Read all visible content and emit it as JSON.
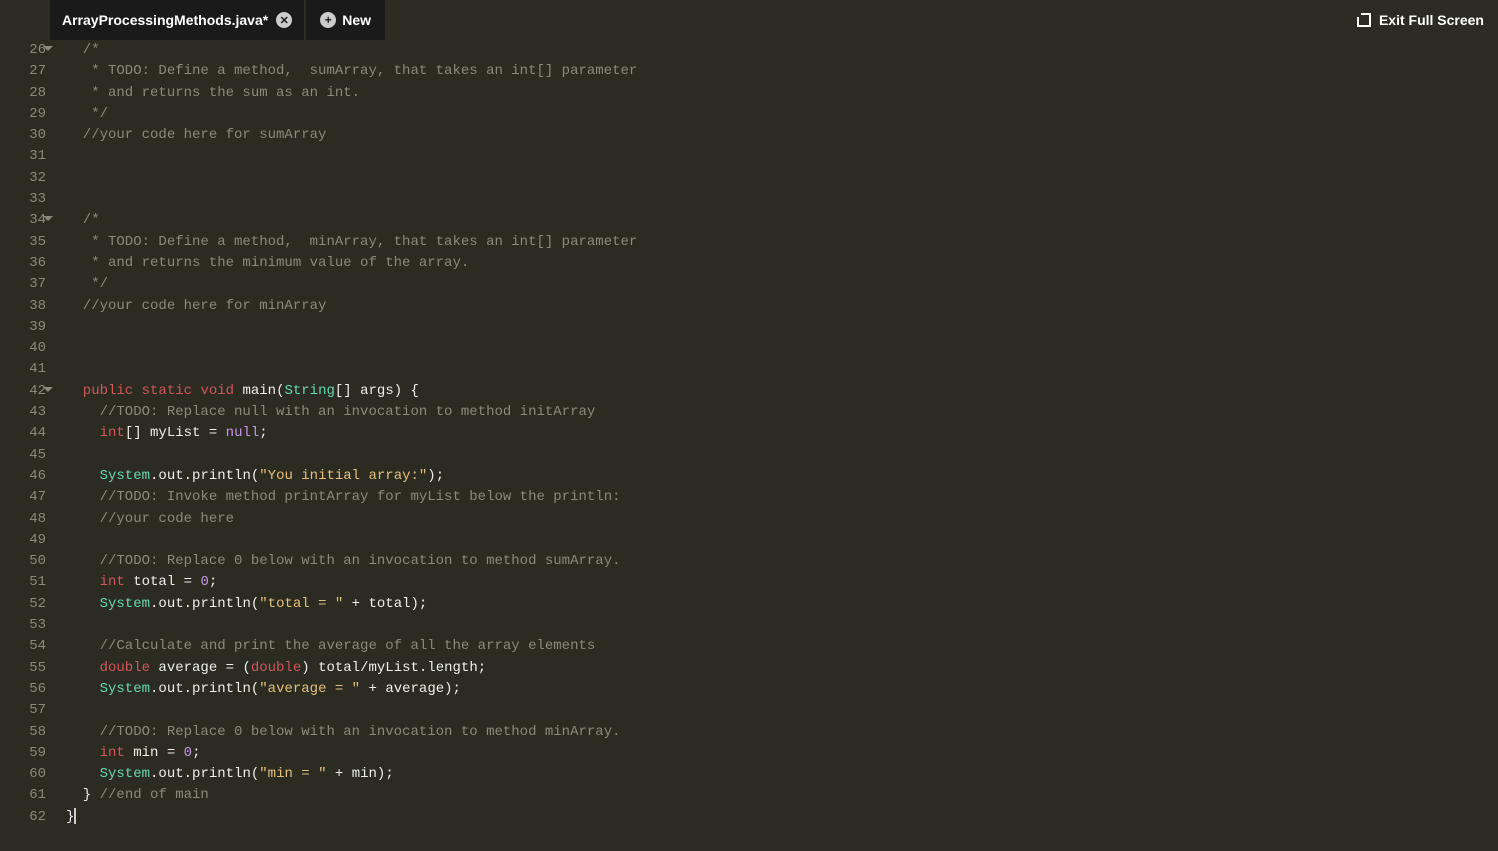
{
  "titlebar": {
    "tab_name": "ArrayProcessingMethods.java*",
    "new_label": "New",
    "exit_label": "Exit Full Screen"
  },
  "gutter": {
    "start": 26,
    "end": 62,
    "folds": [
      26,
      34,
      42
    ]
  },
  "code": {
    "lines": [
      {
        "n": 26,
        "t": "comment",
        "s": "  /*"
      },
      {
        "n": 27,
        "t": "comment",
        "s": "   * TODO: Define a method,  sumArray, that takes an int[] parameter"
      },
      {
        "n": 28,
        "t": "comment",
        "s": "   * and returns the sum as an int."
      },
      {
        "n": 29,
        "t": "comment",
        "s": "   */"
      },
      {
        "n": 30,
        "t": "comment",
        "s": "  //your code here for sumArray"
      },
      {
        "n": 31,
        "t": "blank",
        "s": ""
      },
      {
        "n": 32,
        "t": "blank",
        "s": ""
      },
      {
        "n": 33,
        "t": "blank",
        "s": ""
      },
      {
        "n": 34,
        "t": "comment",
        "s": "  /*"
      },
      {
        "n": 35,
        "t": "comment",
        "s": "   * TODO: Define a method,  minArray, that takes an int[] parameter"
      },
      {
        "n": 36,
        "t": "comment",
        "s": "   * and returns the minimum value of the array."
      },
      {
        "n": 37,
        "t": "comment",
        "s": "   */"
      },
      {
        "n": 38,
        "t": "comment",
        "s": "  //your code here for minArray"
      },
      {
        "n": 39,
        "t": "blank",
        "s": ""
      },
      {
        "n": 40,
        "t": "blank",
        "s": ""
      },
      {
        "n": 41,
        "t": "blank",
        "s": ""
      },
      {
        "n": 42,
        "t": "sig",
        "tokens": [
          {
            "c": "kw",
            "v": "  public "
          },
          {
            "c": "kw",
            "v": "static "
          },
          {
            "c": "kw",
            "v": "void "
          },
          {
            "c": "id",
            "v": "main"
          },
          {
            "c": "punc",
            "v": "("
          },
          {
            "c": "type",
            "v": "String"
          },
          {
            "c": "punc",
            "v": "[] "
          },
          {
            "c": "id",
            "v": "args"
          },
          {
            "c": "punc",
            "v": ") {"
          }
        ]
      },
      {
        "n": 43,
        "t": "comment",
        "s": "    //TODO: Replace null with an invocation to method initArray"
      },
      {
        "n": 44,
        "t": "stmt",
        "tokens": [
          {
            "c": "kw",
            "v": "    int"
          },
          {
            "c": "punc",
            "v": "[] "
          },
          {
            "c": "id",
            "v": "myList"
          },
          {
            "c": "punc",
            "v": " = "
          },
          {
            "c": "lit",
            "v": "null"
          },
          {
            "c": "punc",
            "v": ";"
          }
        ]
      },
      {
        "n": 45,
        "t": "blank",
        "s": ""
      },
      {
        "n": 46,
        "t": "stmt",
        "tokens": [
          {
            "c": "type",
            "v": "    System"
          },
          {
            "c": "punc",
            "v": "."
          },
          {
            "c": "id",
            "v": "out"
          },
          {
            "c": "punc",
            "v": "."
          },
          {
            "c": "id",
            "v": "println"
          },
          {
            "c": "punc",
            "v": "("
          },
          {
            "c": "str",
            "v": "\"You initial array:\""
          },
          {
            "c": "punc",
            "v": ");"
          }
        ]
      },
      {
        "n": 47,
        "t": "comment",
        "s": "    //TODO: Invoke method printArray for myList below the println:"
      },
      {
        "n": 48,
        "t": "comment",
        "s": "    //your code here"
      },
      {
        "n": 49,
        "t": "blank",
        "s": ""
      },
      {
        "n": 50,
        "t": "comment",
        "s": "    //TODO: Replace 0 below with an invocation to method sumArray."
      },
      {
        "n": 51,
        "t": "stmt",
        "tokens": [
          {
            "c": "kw",
            "v": "    int "
          },
          {
            "c": "id",
            "v": "total"
          },
          {
            "c": "punc",
            "v": " = "
          },
          {
            "c": "lit",
            "v": "0"
          },
          {
            "c": "punc",
            "v": ";"
          }
        ]
      },
      {
        "n": 52,
        "t": "stmt",
        "tokens": [
          {
            "c": "type",
            "v": "    System"
          },
          {
            "c": "punc",
            "v": "."
          },
          {
            "c": "id",
            "v": "out"
          },
          {
            "c": "punc",
            "v": "."
          },
          {
            "c": "id",
            "v": "println"
          },
          {
            "c": "punc",
            "v": "("
          },
          {
            "c": "str",
            "v": "\"total = \""
          },
          {
            "c": "punc",
            "v": " + "
          },
          {
            "c": "id",
            "v": "total"
          },
          {
            "c": "punc",
            "v": ");"
          }
        ]
      },
      {
        "n": 53,
        "t": "blank",
        "s": ""
      },
      {
        "n": 54,
        "t": "comment",
        "s": "    //Calculate and print the average of all the array elements"
      },
      {
        "n": 55,
        "t": "stmt",
        "tokens": [
          {
            "c": "kw",
            "v": "    double "
          },
          {
            "c": "id",
            "v": "average"
          },
          {
            "c": "punc",
            "v": " = ("
          },
          {
            "c": "kw",
            "v": "double"
          },
          {
            "c": "punc",
            "v": ") "
          },
          {
            "c": "id",
            "v": "total"
          },
          {
            "c": "punc",
            "v": "/"
          },
          {
            "c": "id",
            "v": "myList"
          },
          {
            "c": "punc",
            "v": "."
          },
          {
            "c": "id",
            "v": "length"
          },
          {
            "c": "punc",
            "v": ";"
          }
        ]
      },
      {
        "n": 56,
        "t": "stmt",
        "tokens": [
          {
            "c": "type",
            "v": "    System"
          },
          {
            "c": "punc",
            "v": "."
          },
          {
            "c": "id",
            "v": "out"
          },
          {
            "c": "punc",
            "v": "."
          },
          {
            "c": "id",
            "v": "println"
          },
          {
            "c": "punc",
            "v": "("
          },
          {
            "c": "str",
            "v": "\"average = \""
          },
          {
            "c": "punc",
            "v": " + "
          },
          {
            "c": "id",
            "v": "average"
          },
          {
            "c": "punc",
            "v": ");"
          }
        ]
      },
      {
        "n": 57,
        "t": "blank",
        "s": ""
      },
      {
        "n": 58,
        "t": "comment",
        "s": "    //TODO: Replace 0 below with an invocation to method minArray."
      },
      {
        "n": 59,
        "t": "stmt",
        "tokens": [
          {
            "c": "kw",
            "v": "    int "
          },
          {
            "c": "id",
            "v": "min"
          },
          {
            "c": "punc",
            "v": " = "
          },
          {
            "c": "lit",
            "v": "0"
          },
          {
            "c": "punc",
            "v": ";"
          }
        ]
      },
      {
        "n": 60,
        "t": "stmt",
        "tokens": [
          {
            "c": "type",
            "v": "    System"
          },
          {
            "c": "punc",
            "v": "."
          },
          {
            "c": "id",
            "v": "out"
          },
          {
            "c": "punc",
            "v": "."
          },
          {
            "c": "id",
            "v": "println"
          },
          {
            "c": "punc",
            "v": "("
          },
          {
            "c": "str",
            "v": "\"min = \""
          },
          {
            "c": "punc",
            "v": " + "
          },
          {
            "c": "id",
            "v": "min"
          },
          {
            "c": "punc",
            "v": ");"
          }
        ]
      },
      {
        "n": 61,
        "t": "mix",
        "tokens": [
          {
            "c": "punc",
            "v": "  } "
          },
          {
            "c": "com",
            "v": "//end of main"
          }
        ]
      },
      {
        "n": 62,
        "t": "stmt",
        "tokens": [
          {
            "c": "punc",
            "v": "}"
          }
        ]
      }
    ]
  }
}
